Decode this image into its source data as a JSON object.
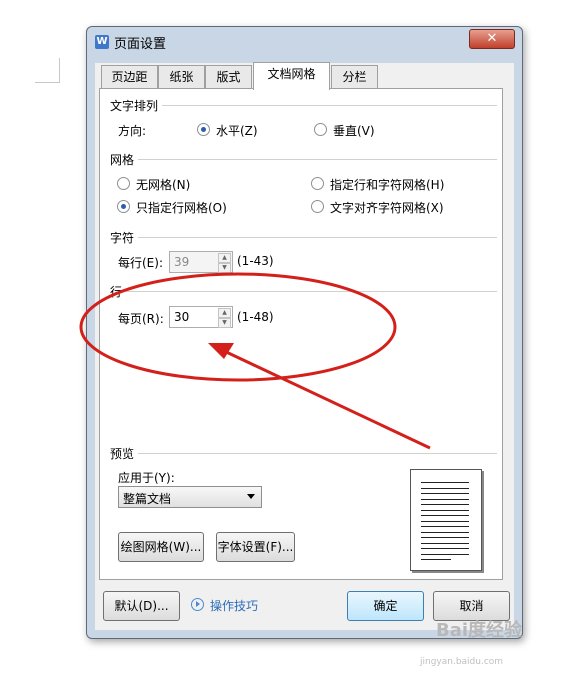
{
  "window": {
    "title": "页面设置",
    "app_icon": "W",
    "close_label": "✕"
  },
  "tabs": [
    {
      "label": "页边距",
      "active": false
    },
    {
      "label": "纸张",
      "active": false
    },
    {
      "label": "版式",
      "active": false
    },
    {
      "label": "文档网格",
      "active": true
    },
    {
      "label": "分栏",
      "active": false
    }
  ],
  "text_layout": {
    "section_title": "文字排列",
    "direction_label": "方向:",
    "horizontal": "水平(Z)",
    "vertical": "垂直(V)",
    "selected": "horizontal"
  },
  "grid": {
    "section_title": "网格",
    "options": [
      {
        "label": "无网格(N)",
        "selected": false
      },
      {
        "label": "指定行和字符网格(H)",
        "selected": false
      },
      {
        "label": "只指定行网格(O)",
        "selected": true
      },
      {
        "label": "文字对齐字符网格(X)",
        "selected": false
      }
    ]
  },
  "chars": {
    "section_title": "字符",
    "per_line_label": "每行(E):",
    "per_line_value": "39",
    "per_line_range": "(1-43)"
  },
  "lines": {
    "section_title": "行",
    "per_page_label": "每页(R):",
    "per_page_value": "30",
    "per_page_range": "(1-48)"
  },
  "preview": {
    "section_title": "预览",
    "apply_label": "应用于(Y):",
    "apply_value": "整篇文档",
    "draw_grid_button": "绘图网格(W)...",
    "font_settings_button": "字体设置(F)..."
  },
  "footer": {
    "default_button": "默认(D)...",
    "tips_link": "操作技巧",
    "ok_button": "确定",
    "cancel_button": "取消"
  },
  "annotation": {
    "color": "#d4201a"
  },
  "watermark": {
    "text": "Bai度经验",
    "url": "jingyan.baidu.com"
  }
}
